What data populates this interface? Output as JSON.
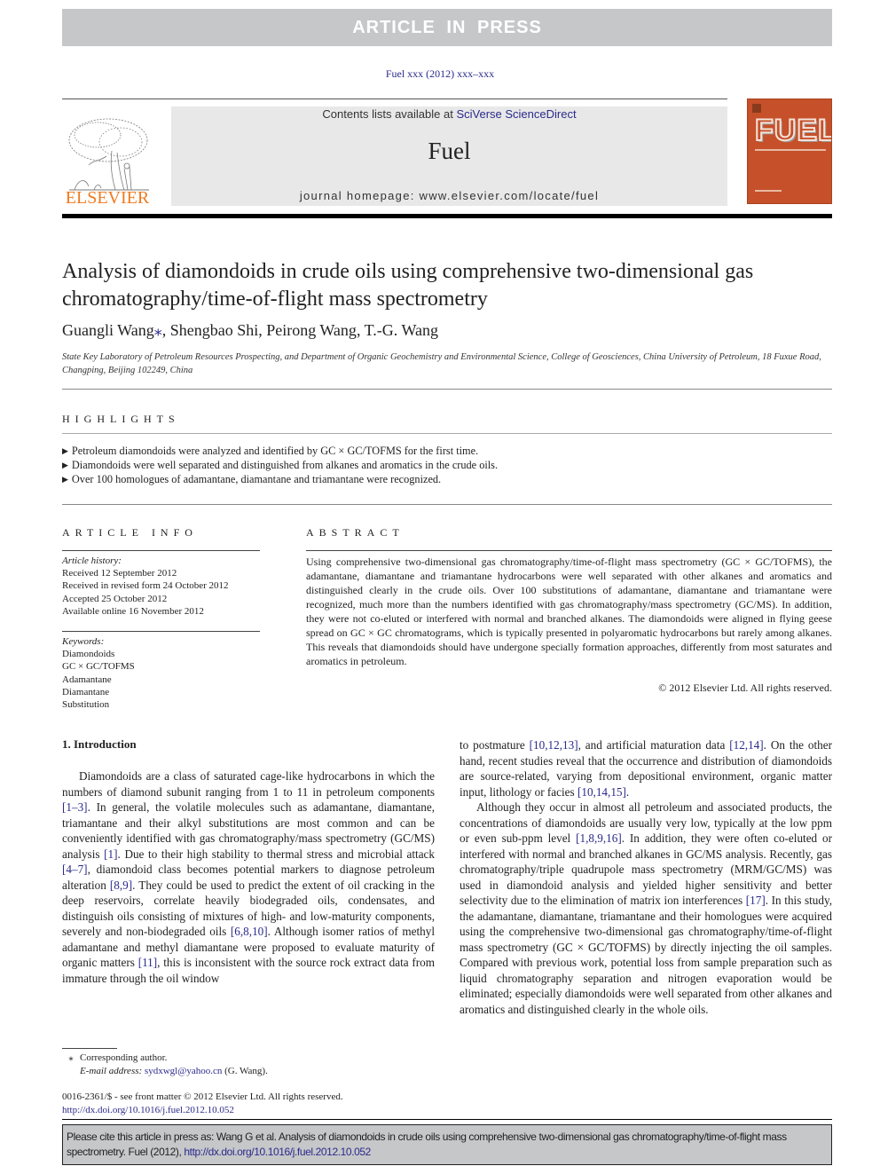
{
  "banner": {
    "label": "ARTICLE IN PRESS"
  },
  "journal_citation": "Fuel xxx (2012) xxx–xxx",
  "header": {
    "publisher_logo_text": "ELSEVIER",
    "contents_prefix": "Contents lists available at ",
    "contents_link": "SciVerse ScienceDirect",
    "journal_name": "Fuel",
    "homepage_prefix": "journal homepage: ",
    "homepage_url": "www.elsevier.com/locate/fuel",
    "cover_title": "FUEL"
  },
  "article": {
    "title": "Analysis of diamondoids in crude oils using comprehensive two-dimensional gas chromatography/time-of-flight mass spectrometry",
    "authors": [
      {
        "name": "Guangli Wang",
        "mark": "⁎"
      },
      {
        "name": "Shengbao Shi"
      },
      {
        "name": "Peirong Wang"
      },
      {
        "name": "T.-G. Wang"
      }
    ],
    "affiliation": "State Key Laboratory of Petroleum Resources Prospecting, and Department of Organic Geochemistry and Environmental Science, College of Geosciences, China University of Petroleum, 18 Fuxue Road, Changping, Beijing 102249, China"
  },
  "highlights": {
    "heading": "HIGHLIGHTS",
    "items": [
      "Petroleum diamondoids were analyzed and identified by GC × GC/TOFMS for the first time.",
      "Diamondoids were well separated and distinguished from alkanes and aromatics in the crude oils.",
      "Over 100 homologues of adamantane, diamantane and triamantane were recognized."
    ]
  },
  "article_info": {
    "heading": "ARTICLE INFO",
    "history_label": "Article history:",
    "history": [
      "Received 12 September 2012",
      "Received in revised form 24 October 2012",
      "Accepted 25 October 2012",
      "Available online 16 November 2012"
    ],
    "keywords_label": "Keywords:",
    "keywords": [
      "Diamondoids",
      "GC × GC/TOFMS",
      "Adamantane",
      "Diamantane",
      "Substitution"
    ]
  },
  "abstract": {
    "heading": "ABSTRACT",
    "text": "Using comprehensive two-dimensional gas chromatography/time-of-flight mass spectrometry (GC × GC/TOFMS), the adamantane, diamantane and triamantane hydrocarbons were well separated with other alkanes and aromatics and distinguished clearly in the crude oils. Over 100 substitutions of adamantane, diamantane and triamantane were recognized, much more than the numbers identified with gas chromatography/mass spectrometry (GC/MS). In addition, they were not co-eluted or interfered with normal and branched alkanes. The diamondoids were aligned in flying geese spread on GC × GC chromatograms, which is typically presented in polyaromatic hydrocarbons but rarely among alkanes. This reveals that diamondoids should have undergone specially formation approaches, differently from most saturates and aromatics in petroleum.",
    "copyright": "© 2012 Elsevier Ltd. All rights reserved."
  },
  "introduction": {
    "heading": "1. Introduction",
    "p1": [
      {
        "t": "Diamondoids are a class of saturated cage-like hydrocarbons in which the numbers of diamond subunit ranging from 1 to 11 in petroleum components "
      },
      {
        "ref": "[1–3]"
      },
      {
        "t": ". In general, the volatile molecules such as adamantane, diamantane, triamantane and their alkyl substitutions are most common and can be conveniently identified with gas chromatography/mass spectrometry (GC/MS) analysis "
      },
      {
        "ref": "[1]"
      },
      {
        "t": ". Due to their high stability to thermal stress and microbial attack "
      },
      {
        "ref": "[4–7]"
      },
      {
        "t": ", diamondoid class becomes potential markers to diagnose petroleum alteration "
      },
      {
        "ref": "[8,9]"
      },
      {
        "t": ". They could be used to predict the extent of oil cracking in the deep reservoirs, correlate heavily biodegraded oils, condensates, and distinguish oils consisting of mixtures of high- and low-maturity components, severely and non-biodegraded oils "
      },
      {
        "ref": "[6,8,10]"
      },
      {
        "t": ". Although isomer ratios of methyl adamantane and methyl diamantane were proposed to evaluate maturity of organic matters "
      },
      {
        "ref": "[11]"
      },
      {
        "t": ", this is inconsistent with the source rock extract data from immature through the oil window to postmature "
      },
      {
        "ref": "[10,12,13]"
      },
      {
        "t": ", and artificial maturation data "
      },
      {
        "ref": "[12,14]"
      },
      {
        "t": ". On the other hand, recent studies reveal that the occurrence and distribution of diamondoids are source-related, varying from depositional environment, organic matter input, lithology or facies "
      },
      {
        "ref": "[10,14,15]"
      },
      {
        "t": "."
      }
    ],
    "p2": [
      {
        "t": "Although they occur in almost all petroleum and associated products, the concentrations of diamondoids are usually very low, typically at the low ppm or even sub-ppm level "
      },
      {
        "ref": "[1,8,9,16]"
      },
      {
        "t": ". In addition, they were often co-eluted or interfered with normal and branched alkanes in GC/MS analysis. Recently, gas chromatography/triple quadrupole mass spectrometry (MRM/GC/MS) was used in diamondoid analysis and yielded higher sensitivity and better selectivity due to the elimination of matrix ion interferences "
      },
      {
        "ref": "[17]"
      },
      {
        "t": ". In this study, the adamantane, diamantane, triamantane and their homologues were acquired using the comprehensive two-dimensional gas chromatography/time-of-flight mass spectrometry (GC × GC/TOFMS) by directly injecting the oil samples. Compared with previous work, potential loss from sample preparation such as liquid chromatography separation and nitrogen evaporation would be eliminated; especially diamondoids were well separated from other alkanes and aromatics and distinguished clearly in the whole oils."
      }
    ]
  },
  "footnote": {
    "star": "⁎",
    "corresponding": "Corresponding author.",
    "email_label": "E-mail address:",
    "email": "sydxwgl@yahoo.cn",
    "email_suffix": " (G. Wang)."
  },
  "front_matter": {
    "issn_line": "0016-2361/$ - see front matter © 2012 Elsevier Ltd. All rights reserved.",
    "doi": "http://dx.doi.org/10.1016/j.fuel.2012.10.052"
  },
  "cite_box": {
    "text": "Please cite this article in press as: Wang G et al. Analysis of diamondoids in crude oils using comprehensive two-dimensional gas chromatography/time-of-flight mass spectrometry. Fuel (2012), ",
    "doi": "http://dx.doi.org/10.1016/j.fuel.2012.10.052"
  }
}
